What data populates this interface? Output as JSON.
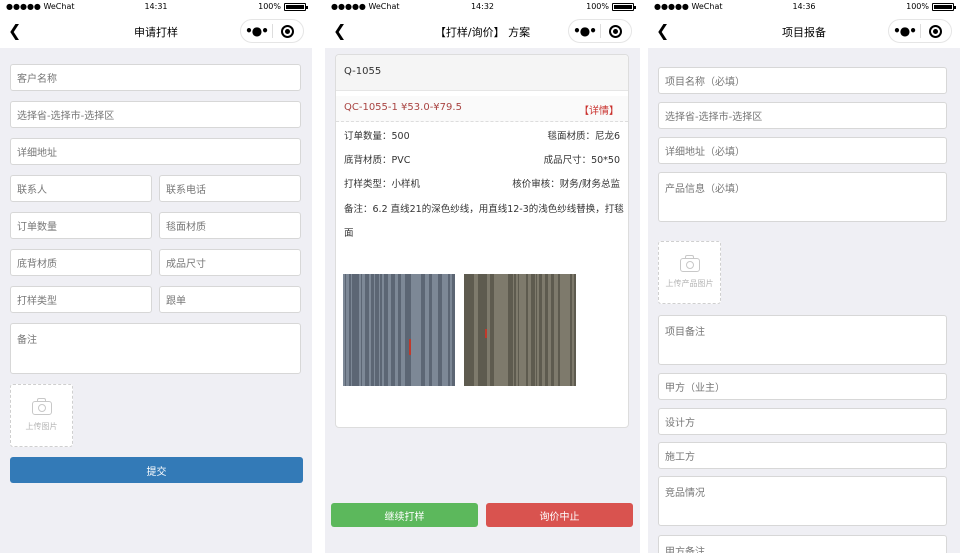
{
  "screens": [
    {
      "status": {
        "carrier": "●●●●● WeChat",
        "time": "14:31",
        "battery": "100%"
      },
      "nav": {
        "title": "申请打样"
      },
      "fields": {
        "customer_name": "客户名称",
        "region": "选择省-选择市-选择区",
        "address": "详细地址",
        "contact": "联系人",
        "phone": "联系电话",
        "order_qty": "订单数量",
        "surface_material": "毯面材质",
        "backing_material": "底背材质",
        "product_size": "成品尺寸",
        "sample_type": "打样类型",
        "follow_up": "跟单",
        "remark": "备注"
      },
      "upload_label": "上传图片",
      "submit_label": "提交"
    },
    {
      "status": {
        "carrier": "●●●●● WeChat",
        "time": "14:32",
        "battery": "100%"
      },
      "nav": {
        "title": "【打样/询价】 方案"
      },
      "card": {
        "code": "Q-1055",
        "quote_line": "QC-1055-1 ¥53.0-¥79.5",
        "detail_link": "【详情】",
        "order_qty": "订单数量：500",
        "surface_material": "毯面材质：尼龙6",
        "backing_material": "底背材质：PVC",
        "product_size": "成品尺寸：50*50",
        "sample_type": "打样类型：小样机",
        "approval": "核价审核：财务/财务总监",
        "remark": "备注：6.2 直线21的深色纱线，用直线12-3的浅色纱线替换，打毯面",
        "swatches": [
          {
            "base": "#7d8896",
            "stripe": "#5c6674",
            "marker": "#c0392b"
          },
          {
            "base": "#7e7a6c",
            "stripe": "#5e5b4f",
            "marker": "#c0392b"
          }
        ]
      },
      "buttons": {
        "continue_label": "继续打样",
        "stop_label": "询价中止",
        "continue_color": "#5cb85c",
        "stop_color": "#d9534f"
      }
    },
    {
      "status": {
        "carrier": "●●●●● WeChat",
        "time": "14:36",
        "battery": "100%"
      },
      "nav": {
        "title": "项目报备"
      },
      "fields": {
        "project_name": "项目名称（必填）",
        "region": "选择省-选择市-选择区",
        "address": "详细地址（必填）",
        "product_info": "产品信息（必填）",
        "project_remark": "项目备注",
        "party_a": "甲方（业主）",
        "designer": "设计方",
        "constructor": "施工方",
        "competitor": "竞品情况",
        "party_a_remark": "甲方备注"
      },
      "upload_label": "上传产品图片"
    }
  ]
}
